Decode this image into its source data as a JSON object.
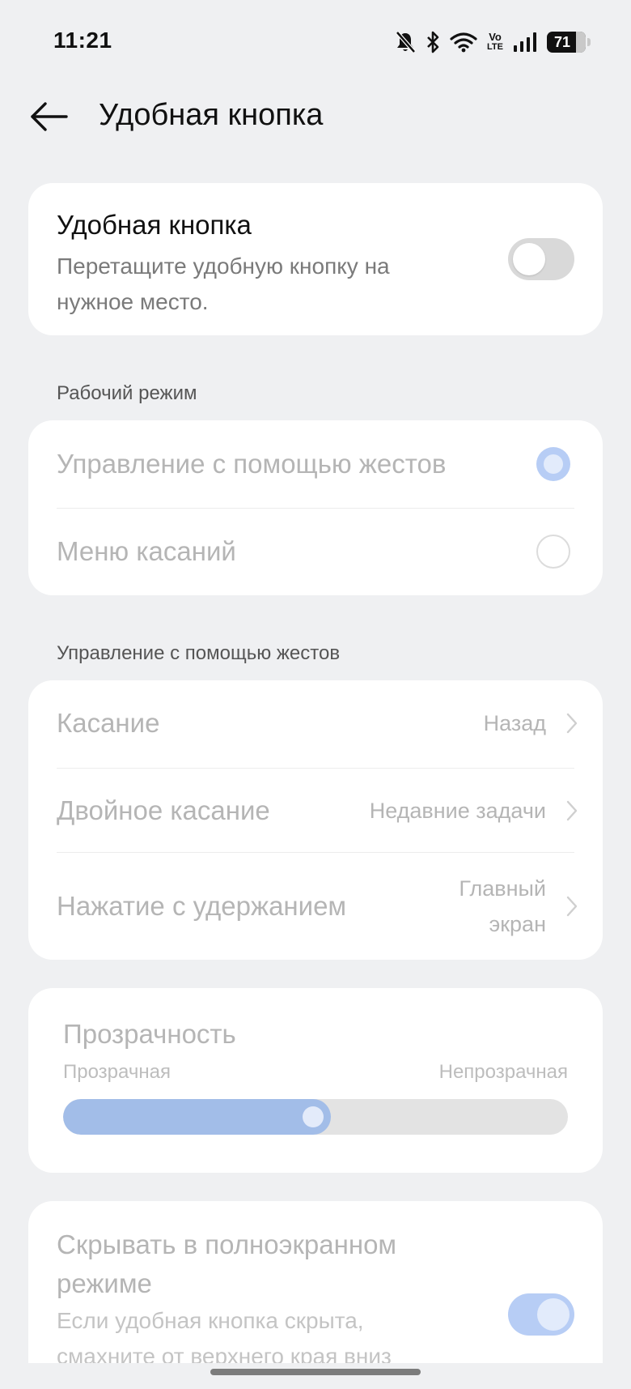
{
  "status_bar": {
    "time": "11:21",
    "icons": [
      "bell-muted-icon",
      "bluetooth-icon",
      "wifi-icon",
      "volte-icon",
      "signal-icon",
      "battery-icon"
    ],
    "volte_top": "Vo",
    "volte_bottom": "LTE",
    "battery_level": "71"
  },
  "header": {
    "back_icon": "arrow-left-icon",
    "title": "Удобная кнопка"
  },
  "main_toggle": {
    "title": "Удобная кнопка",
    "description": "Перетащите удобную кнопку на нужное место.",
    "enabled": false
  },
  "work_mode": {
    "label": "Рабочий режим",
    "options": [
      {
        "label": "Управление с помощью жестов",
        "selected": true
      },
      {
        "label": "Меню касаний",
        "selected": false
      }
    ]
  },
  "gestures": {
    "label": "Управление с помощью жестов",
    "items": [
      {
        "label": "Касание",
        "value": "Назад"
      },
      {
        "label": "Двойное касание",
        "value": "Недавние задачи"
      },
      {
        "label": "Нажатие с удержанием",
        "value_line1": "Главный",
        "value_line2": "экран"
      }
    ]
  },
  "transparency": {
    "title": "Прозрачность",
    "min_label": "Прозрачная",
    "max_label": "Непрозрачная",
    "value_percent": 53
  },
  "fullscreen_hide": {
    "title_line1": "Скрывать в полноэкранном",
    "title_line2": "режиме",
    "description_line1": "Если удобная кнопка скрыта,",
    "description_line2": "смахните от верхнего края вниз",
    "enabled": true
  },
  "colors": {
    "background": "#eff0f2",
    "card": "#ffffff",
    "accent_disabled": "#b7cdf5",
    "slider_fill": "#a2bde8",
    "disabled_text": "#b5b5b5"
  }
}
